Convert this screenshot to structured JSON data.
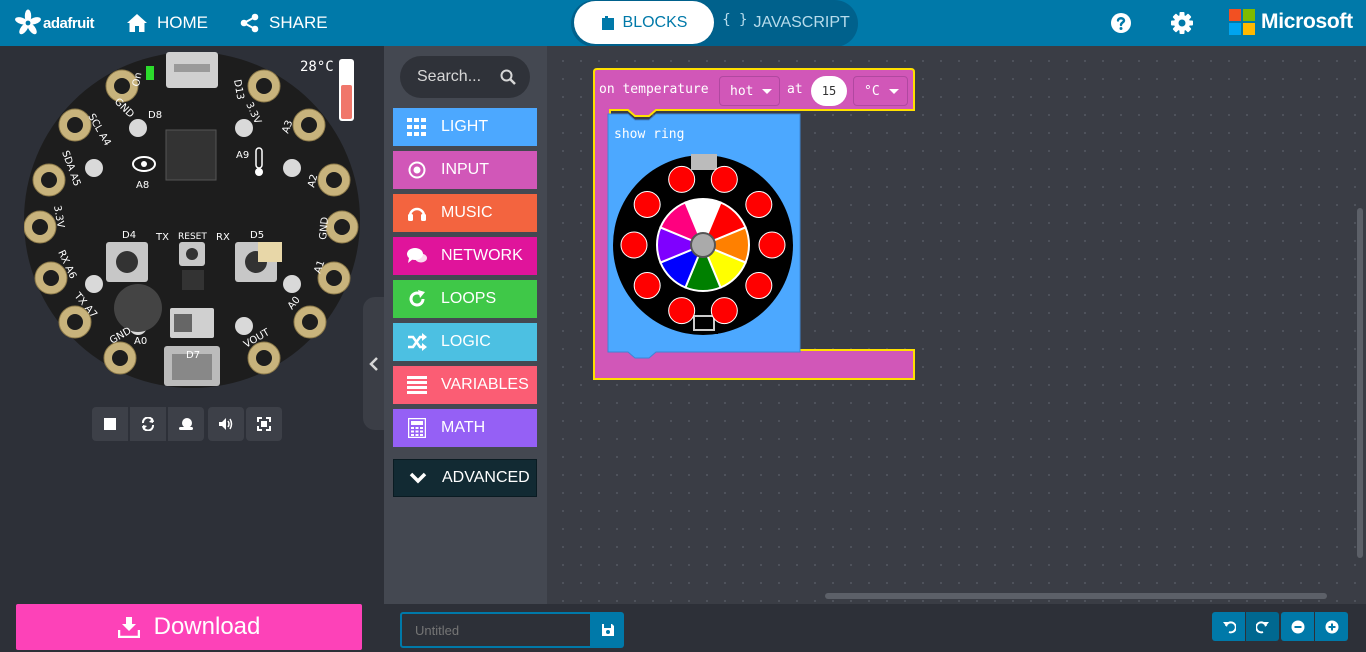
{
  "app": {
    "brand": "adafruit",
    "vendor": "Microsoft",
    "accent_color": "#0079a9"
  },
  "nav": {
    "home_label": "HOME",
    "share_label": "SHARE",
    "blocks_tab": "BLOCKS",
    "javascript_tab": "JAVASCRIPT",
    "javascript_icon": "{ }"
  },
  "simulator": {
    "temperature_label": "28°C",
    "temperature_level": 0.6,
    "board_name": "Circuit Playground",
    "pin_labels": [
      "On",
      "D13",
      "D8",
      "GND",
      "SCL A4",
      "SDA A5",
      "3.3V",
      "RX A6",
      "TX A7",
      "GND",
      "3.3V",
      "A3",
      "A2",
      "GND",
      "A1",
      "A0",
      "VOUT",
      "A9",
      "A8",
      "D4",
      "TX",
      "RESET",
      "RX",
      "D5",
      "A0",
      "D7"
    ],
    "controls": [
      "stop-icon",
      "restart-icon",
      "slow-mo-icon",
      "mute-icon",
      "fullscreen-icon"
    ]
  },
  "download": {
    "label": "Download"
  },
  "toolbox": {
    "search_placeholder": "Search...",
    "categories": [
      {
        "label": "LIGHT",
        "color": "#4ca8ff",
        "icon": "grid-icon"
      },
      {
        "label": "INPUT",
        "color": "#d157b8",
        "icon": "target-icon"
      },
      {
        "label": "MUSIC",
        "color": "#f3643f",
        "icon": "headphones-icon"
      },
      {
        "label": "NETWORK",
        "color": "#e0149b",
        "icon": "chat-icon"
      },
      {
        "label": "LOOPS",
        "color": "#3fc848",
        "icon": "refresh-icon"
      },
      {
        "label": "LOGIC",
        "color": "#4cc0e2",
        "icon": "shuffle-icon"
      },
      {
        "label": "VARIABLES",
        "color": "#fb5d74",
        "icon": "list-icon"
      },
      {
        "label": "MATH",
        "color": "#9560f5",
        "icon": "calculator-icon"
      }
    ],
    "advanced_label": "ADVANCED"
  },
  "workspace": {
    "hat_block": {
      "prefix": "on temperature",
      "condition": "hot",
      "at_label": "at",
      "threshold": "15",
      "unit": "°C",
      "color": "#d157b8"
    },
    "show_ring_block": {
      "label": "show ring",
      "color": "#4ca8ff",
      "outer_pixels": [
        "#ff0000",
        "#ff0000",
        "#ff0000",
        "#ff0000",
        "#ff0000",
        "#ff0000",
        "#ff0000",
        "#ff0000",
        "#ff0000",
        "#ff0000"
      ],
      "palette": [
        "#ffffff",
        "#ff0000",
        "#ff8000",
        "#ffff00",
        "#008000",
        "#0000ff",
        "#7f00ff",
        "#ff007f"
      ]
    }
  },
  "bottom": {
    "project_name_placeholder": "Untitled",
    "buttons": [
      "undo-icon",
      "redo-icon",
      "zoom-out-icon",
      "zoom-in-icon"
    ]
  }
}
